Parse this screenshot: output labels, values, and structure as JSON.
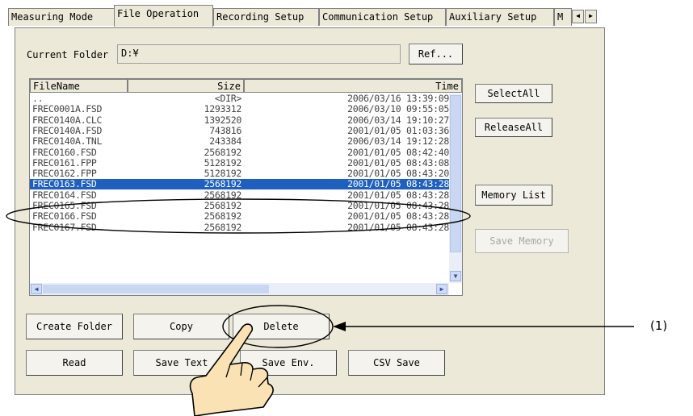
{
  "tabs": [
    {
      "label": "Measuring Mode"
    },
    {
      "label": "File Operation"
    },
    {
      "label": "Recording Setup"
    },
    {
      "label": "Communication Setup"
    },
    {
      "label": "Auxiliary Setup"
    },
    {
      "label": "M"
    }
  ],
  "tab_arrows": {
    "left": "◀",
    "right": "▶"
  },
  "current_folder": {
    "label": "Current Folder",
    "value": "D:¥",
    "ref_button": "Ref..."
  },
  "file_list": {
    "columns": [
      "FileName",
      "Size",
      "Time"
    ],
    "rows": [
      {
        "name": "..",
        "size": "<DIR>",
        "time": "2006/03/16 13:39:09"
      },
      {
        "name": "FREC0001A.FSD",
        "size": "1293312",
        "time": "2006/03/10 09:55:05"
      },
      {
        "name": "FREC0140A.CLC",
        "size": "1392520",
        "time": "2006/03/14 19:10:27"
      },
      {
        "name": "FREC0140A.FSD",
        "size": "743816",
        "time": "2001/01/05 01:03:36"
      },
      {
        "name": "FREC0140A.TNL",
        "size": "243384",
        "time": "2006/03/14 19:12:28"
      },
      {
        "name": "FREC0160.FSD",
        "size": "2568192",
        "time": "2001/01/05 08:42:40"
      },
      {
        "name": "FREC0161.FPP",
        "size": "5128192",
        "time": "2001/01/05 08:43:08"
      },
      {
        "name": "FREC0162.FPP",
        "size": "5128192",
        "time": "2001/01/05 08:43:20"
      },
      {
        "name": "FREC0163.FSD",
        "size": "2568192",
        "time": "2001/01/05 08:43:28",
        "selected": true
      },
      {
        "name": "FREC0164.FSD",
        "size": "2568192",
        "time": "2001/01/05 08:43:28"
      },
      {
        "name": "FREC0165.FSD",
        "size": "2568192",
        "time": "2001/01/05 08:43:28"
      },
      {
        "name": "FREC0166.FSD",
        "size": "2568192",
        "time": "2001/01/05 08:43:28"
      },
      {
        "name": "FREC0167.FSD",
        "size": "2568192",
        "time": "2001/01/05 08:43:28"
      }
    ]
  },
  "side_buttons": {
    "select_all": "SelectAll",
    "release_all": "ReleaseAll",
    "memory_list": "Memory List",
    "save_memory": "Save Memory"
  },
  "bottom_buttons": {
    "create_folder": "Create Folder",
    "copy": "Copy",
    "delete": "Delete",
    "read": "Read",
    "save_text": "Save Text",
    "save_env": "Save Env.",
    "csv_save": "CSV Save"
  },
  "annotation": {
    "label": "(1)"
  },
  "colors": {
    "selection": "#1e5fc0",
    "panel": "#ece9d8"
  }
}
